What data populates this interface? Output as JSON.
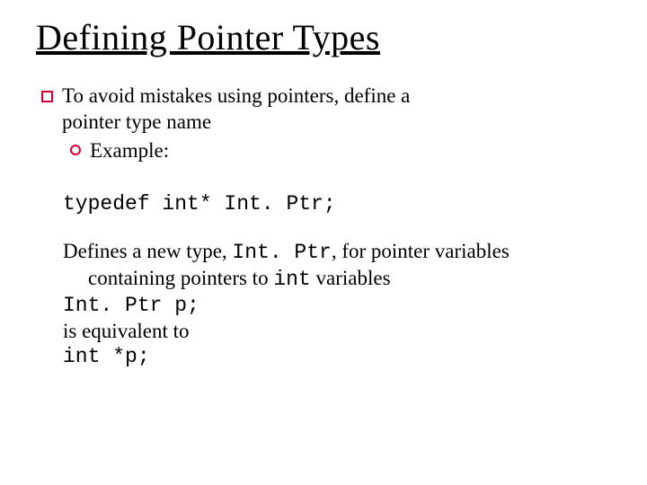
{
  "title": "Defining Pointer Types",
  "bullet1_a": "To avoid mistakes using pointers, define a",
  "bullet1_b": "pointer type name",
  "sub1": "Example:",
  "code_line": "typedef int* Int. Ptr;",
  "p1_a": "Defines a new type, ",
  "p1_code1": "Int. Ptr",
  "p1_b": ", for pointer variables",
  "p1_c": "containing pointers to ",
  "p1_code2": "int",
  "p1_d": " variables",
  "p2_code": "Int. Ptr p;",
  "p3": "is equivalent to",
  "p4_code": "int *p;"
}
